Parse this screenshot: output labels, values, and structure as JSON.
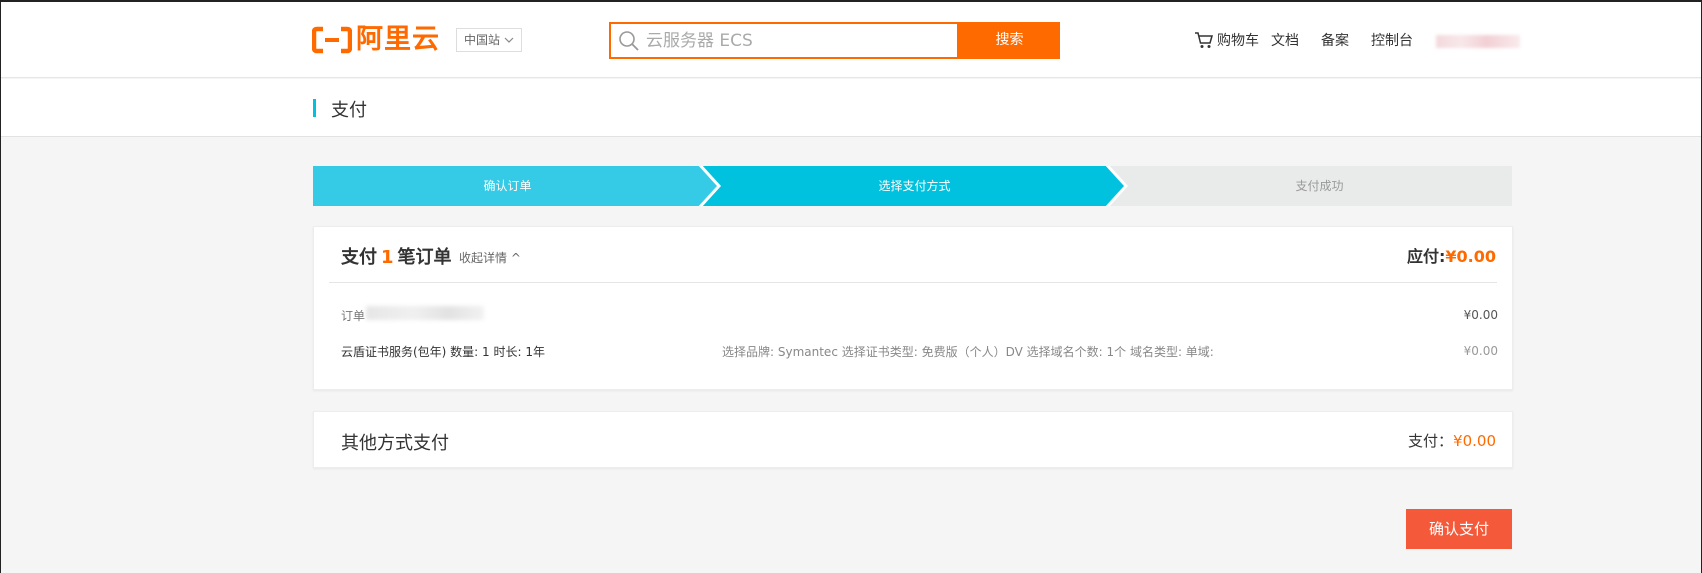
{
  "header": {
    "logo_text": "阿里云",
    "region_label": "中国站",
    "search_placeholder": "云服务器 ECS",
    "search_button": "搜索",
    "nav": {
      "cart": "购物车",
      "docs": "文档",
      "beian": "备案",
      "console": "控制台"
    }
  },
  "page": {
    "title": "支付"
  },
  "steps": [
    {
      "label": "确认订单",
      "state": "done",
      "color": "#35cbe7"
    },
    {
      "label": "选择支付方式",
      "state": "active",
      "color": "#00c1de"
    },
    {
      "label": "支付成功",
      "state": "pending",
      "color": "#e9ebeb"
    }
  ],
  "order_summary": {
    "title_prefix": "支付",
    "count": "1",
    "title_suffix": "笔订单",
    "toggle_label": "收起详情 ^",
    "due_label": "应付:",
    "due_amount": "¥0.00",
    "order_label": "订单",
    "order_amount": "¥0.00",
    "product": "云盾证书服务(包年) 数量: 1 时长: 1年",
    "spec": "选择品牌: Symantec 选择证书类型: 免费版（个人）DV 选择域名个数: 1个 域名类型: 单域:",
    "product_amount": "¥0.00"
  },
  "other_payment": {
    "label": "其他方式支付",
    "pay_label": "支付：",
    "pay_amount": "¥0.00"
  },
  "confirm_button": "确认支付",
  "colors": {
    "brand_orange": "#ff6a00",
    "accent_cyan": "#00c1de",
    "confirm_red": "#f45a3a"
  }
}
